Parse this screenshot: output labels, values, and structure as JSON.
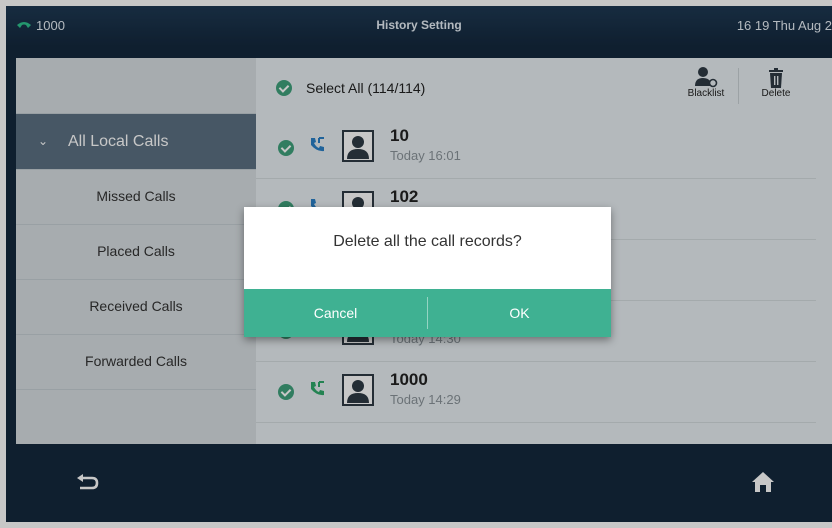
{
  "topbar": {
    "extension": "1000",
    "title": "History Setting",
    "datetime": "16 19 Thu Aug 2"
  },
  "sidebar": {
    "items": [
      {
        "label": "All Local Calls",
        "active": true
      },
      {
        "label": "Missed Calls"
      },
      {
        "label": "Placed Calls"
      },
      {
        "label": "Received Calls"
      },
      {
        "label": "Forwarded Calls"
      }
    ]
  },
  "list": {
    "select_all": "Select All (114/114)",
    "blacklist_label": "Blacklist",
    "delete_label": "Delete",
    "records": [
      {
        "number": "10",
        "time": "Today 16:01"
      },
      {
        "number": "102",
        "time": ""
      },
      {
        "number": "",
        "time": ""
      },
      {
        "number": "",
        "time": "Today 14:30"
      },
      {
        "number": "1000",
        "time": "Today 14:29"
      }
    ]
  },
  "dialog": {
    "message": "Delete all the call records?",
    "cancel": "Cancel",
    "ok": "OK"
  },
  "icons": {
    "phone_ext": "phone-icon",
    "call": "incoming-call-icon",
    "avatar": "contact-avatar-icon",
    "blacklist": "blacklist-icon",
    "delete": "trash-icon",
    "back": "back-arrow-icon",
    "home": "home-icon"
  },
  "colors": {
    "accent": "#3fb192",
    "check": "#3fa07c",
    "active_item": "#5b7082",
    "background": "#14283d"
  }
}
